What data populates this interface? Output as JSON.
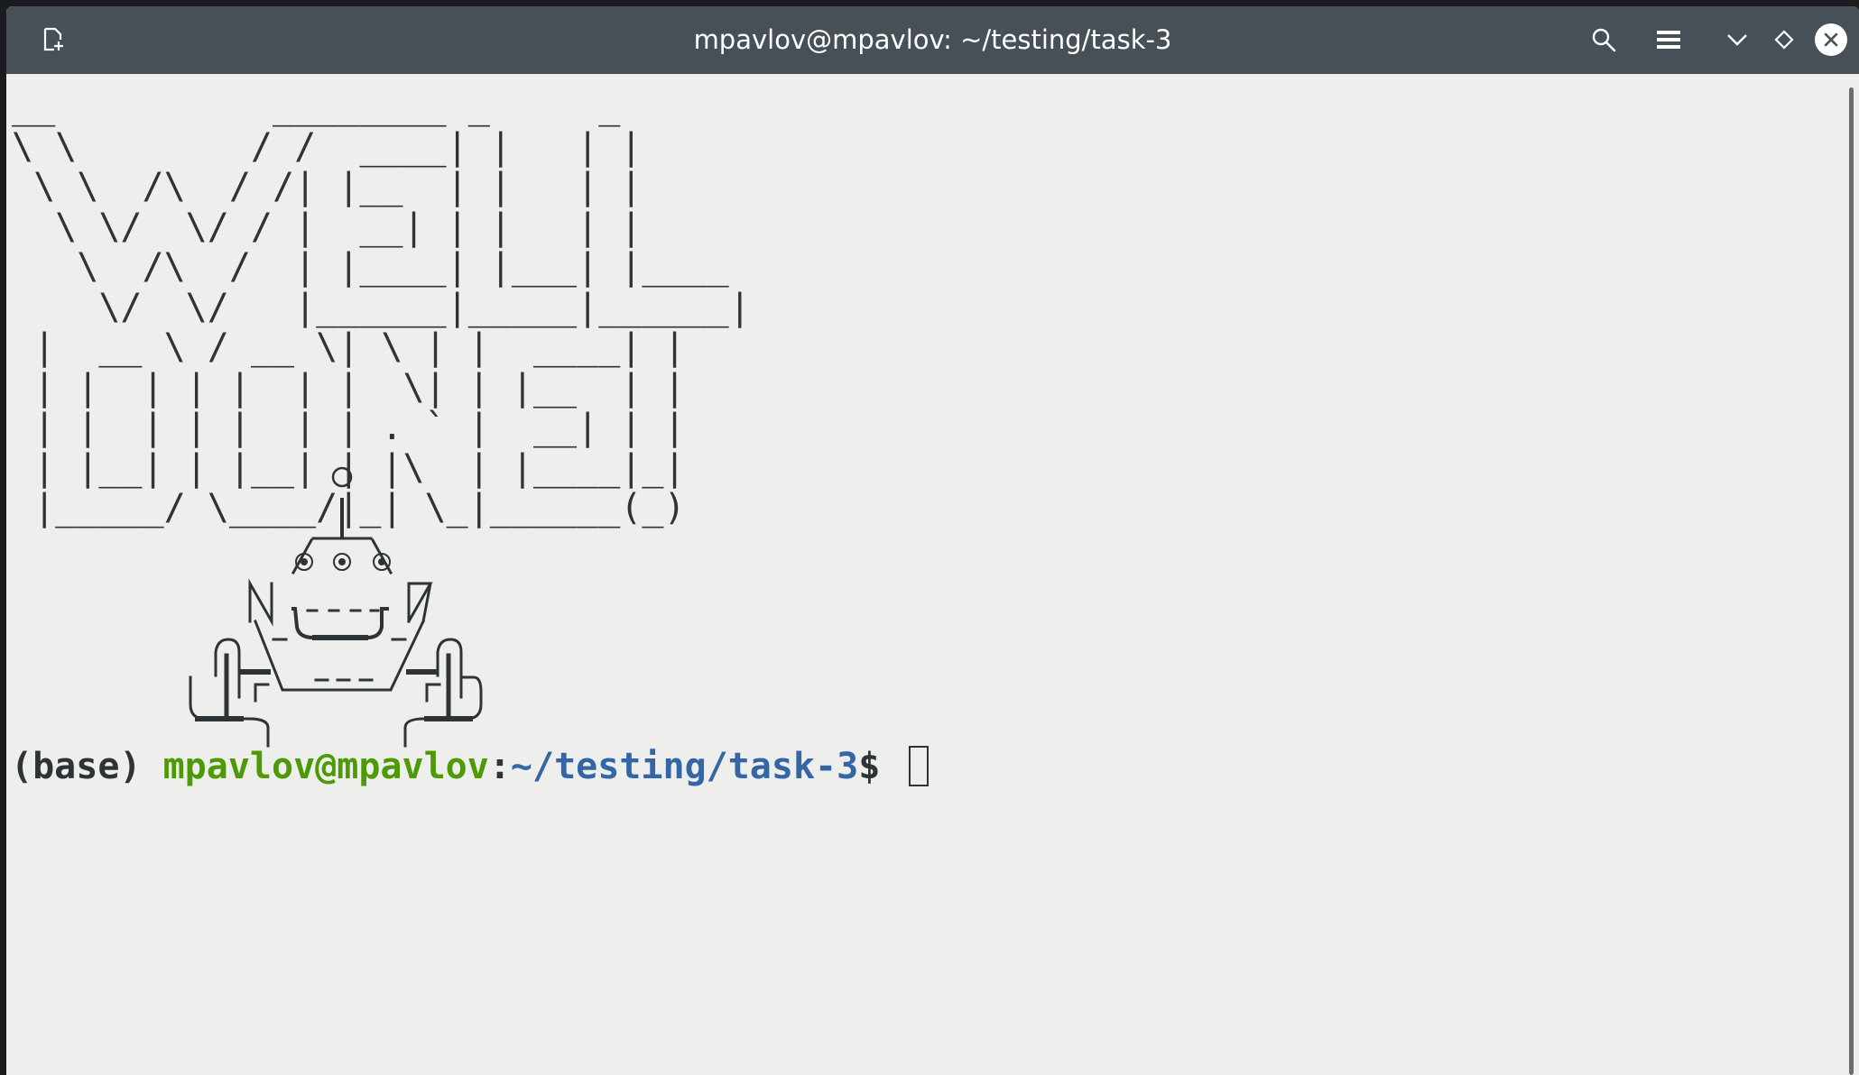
{
  "window": {
    "title": "mpavlov@mpavlov: ~/testing/task-3"
  },
  "headerbar": {
    "new_tab_icon": "new-tab-icon",
    "search_icon": "search-icon",
    "menu_icon": "hamburger-menu-icon",
    "minimize_icon": "chevron-down-icon",
    "maximize_icon": "diamond-icon",
    "close_icon": "close-icon"
  },
  "terminal": {
    "ascii_art": "__          ________ _     _\n\\ \\        / /  ____| |   | |\n \\ \\  /\\  / /| |__  | |   | |\n  \\ \\/  \\/ / |  __| | |   | |\n   \\  /\\  /  | |____| |___| |____\n    \\/  \\/   |______|_____|______|\n |  __ \\ / __ \\| \\ | |  ____| |\n | |  | | |  | |  \\| | |__  | |\n | |  | | |  | | . ` |  __| | |\n | |__| | |__| | |\\  | |____|_|\n |_____/ \\____/|_| \\_|______(_)",
    "prompt": {
      "env": "(base) ",
      "user_host": "mpavlov@mpavlov",
      "separator": ":",
      "path": "~/testing/task-3",
      "symbol": "$ "
    }
  },
  "colors": {
    "headerbar_bg": "#474f57",
    "terminal_bg": "#eeeeec",
    "foreground": "#2e3436",
    "user_host": "#4e9a06",
    "path": "#3465a4"
  }
}
